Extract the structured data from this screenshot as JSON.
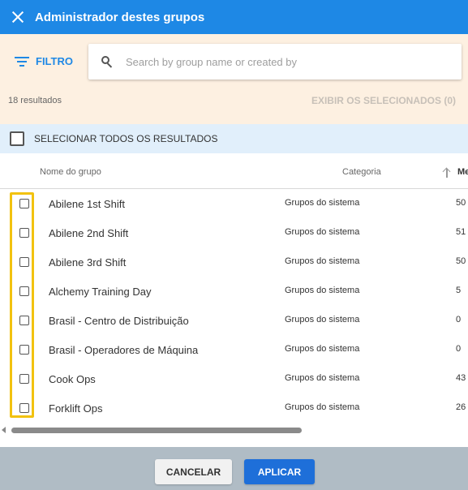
{
  "header": {
    "title": "Administrador destes grupos",
    "close_icon": "close-icon"
  },
  "filter": {
    "filter_label": "FILTRO",
    "search_placeholder": "Search by group name or created by",
    "search_value": "",
    "results_text": "18 resultados",
    "show_selected_label": "EXIBIR OS SELECIONADOS (0)"
  },
  "select_all": {
    "label": "SELECIONAR TODOS OS RESULTADOS",
    "checked": false
  },
  "table": {
    "columns": {
      "name": "Nome do grupo",
      "category": "Categoria",
      "members": "Me"
    },
    "sort_icon": "arrow-up-icon",
    "rows": [
      {
        "name": "Abilene 1st Shift",
        "category": "Grupos do sistema",
        "members": "50"
      },
      {
        "name": "Abilene 2nd Shift",
        "category": "Grupos do sistema",
        "members": "51"
      },
      {
        "name": "Abilene 3rd Shift",
        "category": "Grupos do sistema",
        "members": "50"
      },
      {
        "name": "Alchemy Training Day",
        "category": "Grupos do sistema",
        "members": "5"
      },
      {
        "name": "Brasil - Centro de Distribuição",
        "category": "Grupos do sistema",
        "members": "0"
      },
      {
        "name": "Brasil - Operadores de Máquina",
        "category": "Grupos do sistema",
        "members": "0"
      },
      {
        "name": "Cook Ops",
        "category": "Grupos do sistema",
        "members": "43"
      },
      {
        "name": "Forklift Ops",
        "category": "Grupos do sistema",
        "members": "26"
      }
    ]
  },
  "footer": {
    "cancel_label": "CANCELAR",
    "apply_label": "APLICAR"
  },
  "colors": {
    "header": "#1e88e5",
    "filter_bg": "#fdf0e1",
    "select_all_bg": "#e1effb",
    "highlight": "#f2c20f",
    "footer_bg": "#b0bcc5",
    "apply": "#1e6fd9"
  }
}
